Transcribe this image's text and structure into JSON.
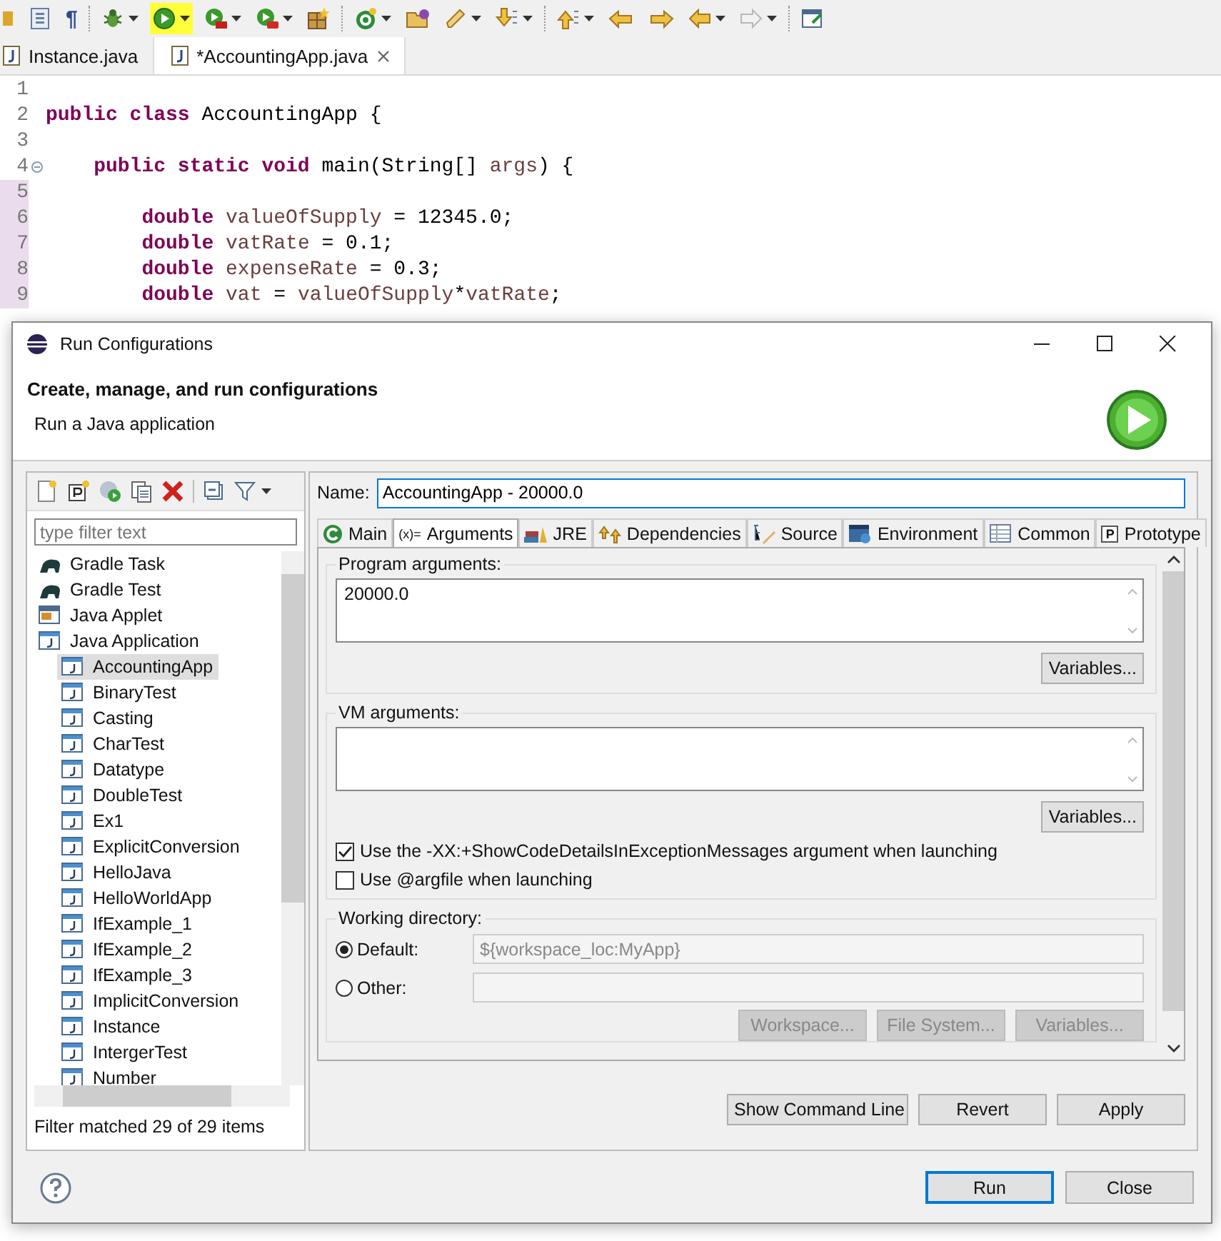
{
  "toolbar": [
    {
      "kind": "partial",
      "dropdown": false,
      "highlighted": false
    },
    {
      "kind": "outline",
      "dropdown": false,
      "highlighted": false
    },
    {
      "kind": "glyph",
      "glyph": "¶",
      "dropdown": false,
      "highlighted": false
    },
    {
      "kind": "bug",
      "dropdown": true,
      "highlighted": false
    },
    {
      "kind": "run",
      "dropdown": true,
      "highlighted": true
    },
    {
      "kind": "coverage",
      "dropdown": true,
      "highlighted": false
    },
    {
      "kind": "external",
      "dropdown": true,
      "highlighted": false
    },
    {
      "kind": "box",
      "dropdown": false,
      "highlighted": false
    },
    {
      "kind": "new",
      "dropdown": true,
      "highlighted": false
    },
    {
      "kind": "folder",
      "dropdown": false,
      "highlighted": false
    },
    {
      "kind": "pen",
      "dropdown": true,
      "highlighted": false
    },
    {
      "kind": "down",
      "dropdown": true,
      "highlighted": false
    },
    {
      "kind": "up",
      "dropdown": true,
      "highlighted": false
    },
    {
      "kind": "back-star",
      "dropdown": false,
      "highlighted": false
    },
    {
      "kind": "fwd-star",
      "dropdown": false,
      "highlighted": false
    },
    {
      "kind": "back",
      "dropdown": true,
      "highlighted": false
    },
    {
      "kind": "forward",
      "dropdown": true,
      "highlighted": false,
      "disabled": true
    },
    {
      "kind": "perspective",
      "dropdown": false,
      "highlighted": false
    }
  ],
  "editor_tabs": [
    {
      "label": "Instance.java",
      "selected": false,
      "closable": false
    },
    {
      "label": "*AccountingApp.java",
      "selected": true,
      "closable": true
    }
  ],
  "code_lines": [
    {
      "number": "1"
    },
    {
      "number": "2",
      "segments": [
        {
          "kind": "keyword",
          "text": "public class "
        },
        {
          "kind": "plain",
          "text": "AccountingApp {"
        }
      ]
    },
    {
      "number": "3"
    },
    {
      "number": "4",
      "folded": false,
      "segments": [
        {
          "kind": "keyword",
          "text": "    public static void "
        },
        {
          "kind": "plain",
          "text": "main(String[] "
        },
        {
          "kind": "param",
          "text": "args"
        },
        {
          "kind": "plain",
          "text": ") {"
        }
      ]
    },
    {
      "number": "5",
      "changed": true
    },
    {
      "number": "6",
      "changed": true,
      "segments": [
        {
          "kind": "keyword",
          "text": "        double "
        },
        {
          "kind": "local",
          "text": "valueOfSupply"
        },
        {
          "kind": "plain",
          "text": " = 12345.0;"
        }
      ]
    },
    {
      "number": "7",
      "changed": true,
      "segments": [
        {
          "kind": "keyword",
          "text": "        double "
        },
        {
          "kind": "local",
          "text": "vatRate"
        },
        {
          "kind": "plain",
          "text": " = 0.1;"
        }
      ]
    },
    {
      "number": "8",
      "changed": true,
      "segments": [
        {
          "kind": "keyword",
          "text": "        double "
        },
        {
          "kind": "local",
          "text": "expenseRate"
        },
        {
          "kind": "plain",
          "text": " = 0.3;"
        }
      ]
    },
    {
      "number": "9",
      "changed": true,
      "segments": [
        {
          "kind": "keyword",
          "text": "        double "
        },
        {
          "kind": "local",
          "text": "vat"
        },
        {
          "kind": "plain",
          "text": " = "
        },
        {
          "kind": "local",
          "text": "valueOfSupply"
        },
        {
          "kind": "plain",
          "text": "*"
        },
        {
          "kind": "local",
          "text": "vatRate"
        },
        {
          "kind": "plain",
          "text": ";"
        }
      ]
    }
  ],
  "dialog": {
    "title": "Run Configurations",
    "heading": "Create, manage, and run configurations",
    "subheading": "Run a Java application",
    "side_toolbar": [
      {
        "kind": "new"
      },
      {
        "kind": "prototype"
      },
      {
        "kind": "launch-group"
      },
      {
        "kind": "duplicate"
      },
      {
        "kind": "delete"
      },
      {
        "kind": "collapse"
      },
      {
        "kind": "filter"
      }
    ],
    "filter": {
      "placeholder": "type filter text"
    },
    "tree": [
      {
        "label": "Gradle Task",
        "kind": "gradle",
        "selected": false
      },
      {
        "label": "Gradle Test",
        "kind": "gradle",
        "selected": false
      },
      {
        "label": "Java Applet",
        "kind": "applet",
        "selected": false
      },
      {
        "label": "Java Application",
        "kind": "app",
        "selected": false,
        "children": [
          {
            "label": "AccountingApp",
            "selected": true
          },
          {
            "label": "BinaryTest",
            "selected": false
          },
          {
            "label": "Casting",
            "selected": false
          },
          {
            "label": "CharTest",
            "selected": false
          },
          {
            "label": "Datatype",
            "selected": false
          },
          {
            "label": "DoubleTest",
            "selected": false
          },
          {
            "label": "Ex1",
            "selected": false
          },
          {
            "label": "ExplicitConversion",
            "selected": false
          },
          {
            "label": "HelloJava",
            "selected": false
          },
          {
            "label": "HelloWorldApp",
            "selected": false
          },
          {
            "label": "IfExample_1",
            "selected": false
          },
          {
            "label": "IfExample_2",
            "selected": false
          },
          {
            "label": "IfExample_3",
            "selected": false
          },
          {
            "label": "ImplicitConversion",
            "selected": false
          },
          {
            "label": "Instance",
            "selected": false
          },
          {
            "label": "IntergerTest",
            "selected": false
          },
          {
            "label": "Number",
            "selected": false
          }
        ]
      }
    ],
    "filter_status": "Filter matched 29 of 29 items",
    "name_label": "Name:",
    "name_value": "AccountingApp - 20000.0",
    "tabs": [
      {
        "label": "Main",
        "kind": "main",
        "selected": false
      },
      {
        "label": "Arguments",
        "kind": "glyph",
        "glyph": "(x)=",
        "selected": true
      },
      {
        "label": "JRE",
        "kind": "jre",
        "selected": false
      },
      {
        "label": "Dependencies",
        "kind": "deps",
        "selected": false
      },
      {
        "label": "Source",
        "kind": "source",
        "selected": false
      },
      {
        "label": "Environment",
        "kind": "env",
        "selected": false
      },
      {
        "label": "Common",
        "kind": "common",
        "selected": false
      },
      {
        "label": "Prototype",
        "kind": "proto",
        "glyph": "P",
        "selected": false
      }
    ],
    "program_arguments": {
      "label": "Program arguments:",
      "value": "20000.0",
      "button": "Variables..."
    },
    "vm_arguments": {
      "label": "VM arguments:",
      "button": "Variables..."
    },
    "options": [
      {
        "label": "Use the -XX:+ShowCodeDetailsInExceptionMessages argument when launching",
        "checked": true
      },
      {
        "label": "Use @argfile when launching",
        "checked": false
      }
    ],
    "working_directory": {
      "label": "Working directory:",
      "choices": [
        {
          "label": "Default:",
          "selected": true,
          "value": "${workspace_loc:MyApp}"
        },
        {
          "label": "Other:",
          "selected": false
        }
      ],
      "buttons": [
        {
          "label": "Workspace...",
          "disabled": true
        },
        {
          "label": "File System...",
          "disabled": true
        },
        {
          "label": "Variables...",
          "disabled": true
        }
      ]
    },
    "panel_buttons": [
      "Show Command Line",
      "Revert",
      "Apply"
    ],
    "footer_buttons": [
      {
        "label": "Run",
        "default": true
      },
      {
        "label": "Close",
        "default": false
      }
    ]
  }
}
